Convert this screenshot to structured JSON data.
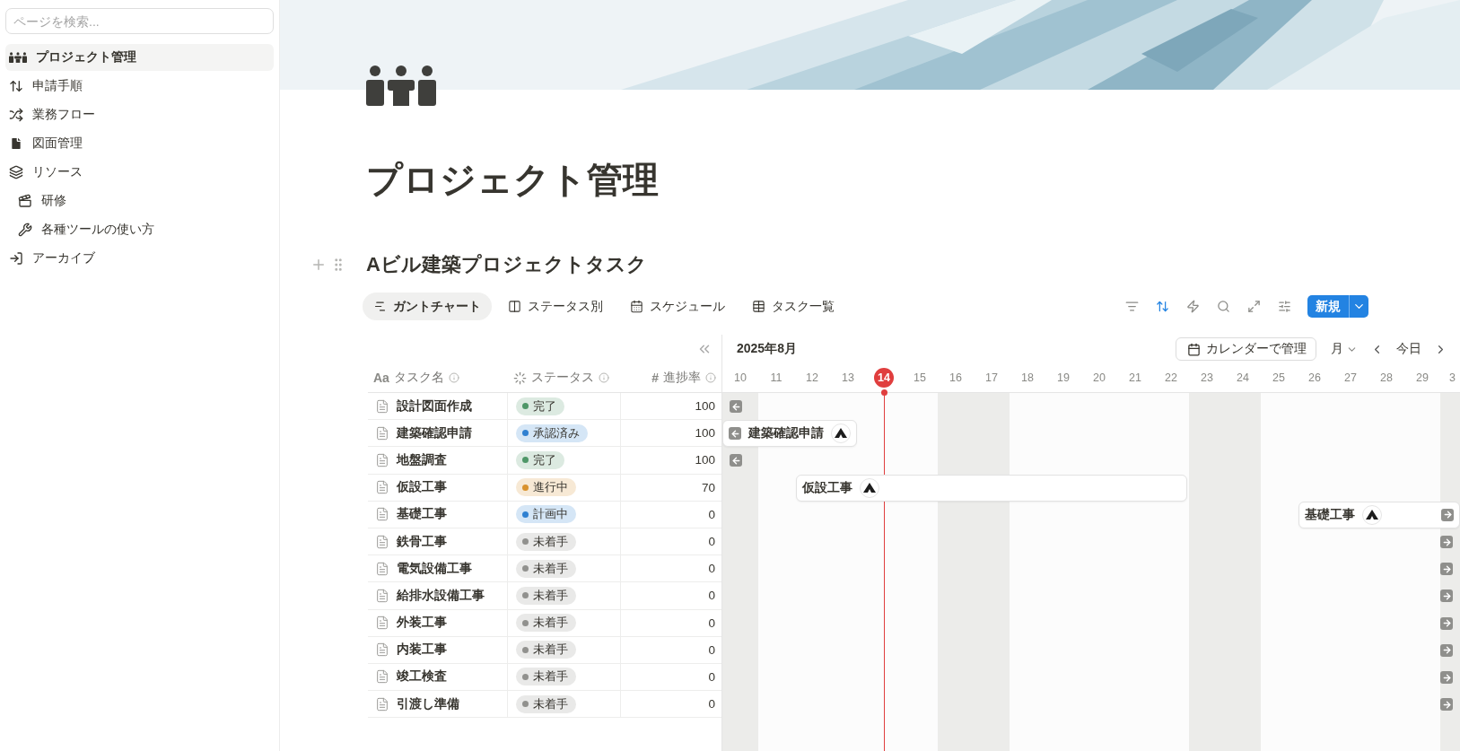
{
  "sidebar": {
    "search": {
      "placeholder": "ページを検索..."
    },
    "items": [
      {
        "label": "プロジェクト管理",
        "selected": true
      },
      {
        "label": "申請手順",
        "selected": false
      },
      {
        "label": "業務フロー",
        "selected": false
      },
      {
        "label": "図面管理",
        "selected": false
      },
      {
        "label": "リソース",
        "selected": false,
        "children": [
          {
            "label": "研修",
            "selected": false
          },
          {
            "label": "各種ツールの使い方",
            "selected": false
          }
        ]
      },
      {
        "label": "アーカイブ",
        "selected": false
      }
    ]
  },
  "page": {
    "title": "プロジェクト管理"
  },
  "database": {
    "title": "Aビル建築プロジェクトタスク",
    "tabs": [
      {
        "label": "ガントチャート",
        "selected": true
      },
      {
        "label": "ステータス別",
        "selected": false
      },
      {
        "label": "スケジュール",
        "selected": false
      },
      {
        "label": "タスク一覧",
        "selected": false
      }
    ],
    "new_button": "新規",
    "columns": [
      {
        "label": "タスク名",
        "icon_text": "Aa",
        "kind": "title"
      },
      {
        "label": "ステータス",
        "kind": "status"
      },
      {
        "label": "進捗率",
        "icon_text": "#",
        "kind": "number"
      }
    ],
    "timeline": {
      "month": "2025年8月",
      "calendar_button": "カレンダーで管理",
      "scale": "月",
      "today_button": "今日",
      "days": [
        {
          "label": "10",
          "weekend": true,
          "today": false
        },
        {
          "label": "11",
          "weekend": false,
          "today": false
        },
        {
          "label": "12",
          "weekend": false,
          "today": false
        },
        {
          "label": "13",
          "weekend": false,
          "today": false
        },
        {
          "label": "14",
          "weekend": false,
          "today": true
        },
        {
          "label": "15",
          "weekend": false,
          "today": false
        },
        {
          "label": "16",
          "weekend": true,
          "today": false
        },
        {
          "label": "17",
          "weekend": true,
          "today": false
        },
        {
          "label": "18",
          "weekend": false,
          "today": false
        },
        {
          "label": "19",
          "weekend": false,
          "today": false
        },
        {
          "label": "20",
          "weekend": false,
          "today": false
        },
        {
          "label": "21",
          "weekend": false,
          "today": false
        },
        {
          "label": "22",
          "weekend": false,
          "today": false
        },
        {
          "label": "23",
          "weekend": true,
          "today": false
        },
        {
          "label": "24",
          "weekend": true,
          "today": false
        },
        {
          "label": "25",
          "weekend": false,
          "today": false
        },
        {
          "label": "26",
          "weekend": false,
          "today": false
        },
        {
          "label": "27",
          "weekend": false,
          "today": false
        },
        {
          "label": "28",
          "weekend": false,
          "today": false
        },
        {
          "label": "29",
          "weekend": false,
          "today": false
        },
        {
          "label": "3",
          "weekend": true,
          "today": false
        }
      ]
    },
    "rows": [
      {
        "name": "設計図面作成",
        "status": {
          "label": "完了",
          "color": "#4f9768"
        },
        "progress": "100",
        "gantt": {
          "kind": "off_left"
        }
      },
      {
        "name": "建築確認申請",
        "status": {
          "label": "承認済み",
          "color": "#2f80d1"
        },
        "progress": "100",
        "gantt": {
          "kind": "bar",
          "label": "建築確認申請"
        }
      },
      {
        "name": "地盤調査",
        "status": {
          "label": "完了",
          "color": "#4f9768"
        },
        "progress": "100",
        "gantt": {
          "kind": "off_left"
        }
      },
      {
        "name": "仮設工事",
        "status": {
          "label": "進行中",
          "color": "#d9922e"
        },
        "progress": "70",
        "gantt": {
          "kind": "bar",
          "label": "仮設工事"
        }
      },
      {
        "name": "基礎工事",
        "status": {
          "label": "計画中",
          "color": "#2f80d1"
        },
        "progress": "0",
        "gantt": {
          "kind": "bar",
          "label": "基礎工事"
        }
      },
      {
        "name": "鉄骨工事",
        "status": {
          "label": "未着手",
          "color": "#91918e"
        },
        "progress": "0",
        "gantt": {
          "kind": "off_right"
        }
      },
      {
        "name": "電気設備工事",
        "status": {
          "label": "未着手",
          "color": "#91918e"
        },
        "progress": "0",
        "gantt": {
          "kind": "off_right"
        }
      },
      {
        "name": "給排水設備工事",
        "status": {
          "label": "未着手",
          "color": "#91918e"
        },
        "progress": "0",
        "gantt": {
          "kind": "off_right"
        }
      },
      {
        "name": "外装工事",
        "status": {
          "label": "未着手",
          "color": "#91918e"
        },
        "progress": "0",
        "gantt": {
          "kind": "off_right"
        }
      },
      {
        "name": "内装工事",
        "status": {
          "label": "未着手",
          "color": "#91918e"
        },
        "progress": "0",
        "gantt": {
          "kind": "off_right"
        }
      },
      {
        "name": "竣工検査",
        "status": {
          "label": "未着手",
          "color": "#91918e"
        },
        "progress": "0",
        "gantt": {
          "kind": "off_right"
        }
      },
      {
        "name": "引渡し準備",
        "status": {
          "label": "未着手",
          "color": "#91918e"
        },
        "progress": "0",
        "gantt": {
          "kind": "off_right"
        }
      }
    ]
  }
}
